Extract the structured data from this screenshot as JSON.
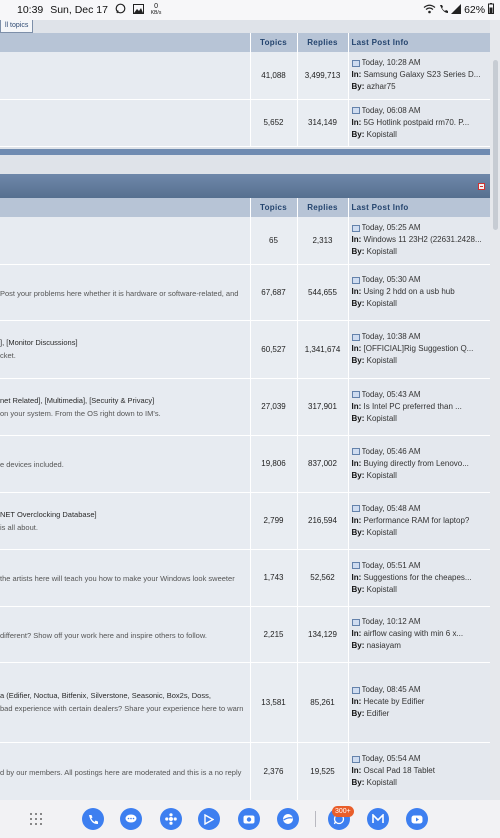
{
  "status_bar": {
    "time": "10:39",
    "date": "Sun, Dec 17",
    "kbs": "0",
    "kbs_unit": "KB/s",
    "battery": "62%"
  },
  "tab_stub": {
    "label": "ll topics"
  },
  "section1": {
    "headers": {
      "topics": "Topics",
      "replies": "Replies",
      "last": "Last Post Info"
    },
    "rows": [
      {
        "title": "",
        "desc": "",
        "topics": "41,088",
        "replies": "3,499,713",
        "time": "Today, 10:28 AM",
        "in_label": "In:",
        "in": "Samsung Galaxy S23 Series D...",
        "by_label": "By:",
        "by": "azhar75"
      },
      {
        "title": "",
        "desc": "",
        "topics": "5,652",
        "replies": "314,149",
        "time": "Today, 06:08 AM",
        "in_label": "In:",
        "in": "5G Hotlink postpaid rm70. P...",
        "by_label": "By:",
        "by": "Kopistall"
      }
    ]
  },
  "section2": {
    "headers": {
      "topics": "Topics",
      "replies": "Replies",
      "last": "Last Post Info"
    },
    "rows": [
      {
        "title": "",
        "desc": "",
        "topics": "65",
        "replies": "2,313",
        "time": "Today, 05:25 AM",
        "in_label": "In:",
        "in": "Windows 11 23H2 (22631.2428...",
        "by_label": "By:",
        "by": "Kopistall"
      },
      {
        "title": "",
        "desc": "Post your problems here whether it is hardware or software-related, and",
        "topics": "67,687",
        "replies": "544,655",
        "time": "Today, 05:30 AM",
        "in_label": "In:",
        "in": "Using 2 hdd on a usb hub",
        "by_label": "By:",
        "by": "Kopistall"
      },
      {
        "title": "], [Monitor Discussions]",
        "desc": "cket.",
        "topics": "60,527",
        "replies": "1,341,674",
        "time": "Today, 10:38 AM",
        "in_label": "In:",
        "in": "[OFFICIAL]Rig Suggestion Q...",
        "by_label": "By:",
        "by": "Kopistall"
      },
      {
        "title": "net Related], [Multimedia], [Security & Privacy]",
        "desc": "on your system. From the OS right down to IM's.",
        "topics": "27,039",
        "replies": "317,901",
        "time": "Today, 05:43 AM",
        "in_label": "In:",
        "in": "Is Intel PC preferred than ...",
        "by_label": "By:",
        "by": "Kopistall"
      },
      {
        "title": "",
        "desc": "e devices included.",
        "topics": "19,806",
        "replies": "837,002",
        "time": "Today, 05:46 AM",
        "in_label": "In:",
        "in": "Buying directly from Lenovo...",
        "by_label": "By:",
        "by": "Kopistall"
      },
      {
        "title": "NET Overclocking Database]",
        "desc": "is all about.",
        "topics": "2,799",
        "replies": "216,594",
        "time": "Today, 05:48 AM",
        "in_label": "In:",
        "in": "Performance RAM for laptop?",
        "by_label": "By:",
        "by": "Kopistall"
      },
      {
        "title": "",
        "desc": "the artists here will teach you how to make your Windows look sweeter",
        "topics": "1,743",
        "replies": "52,562",
        "time": "Today, 05:51 AM",
        "in_label": "In:",
        "in": "Suggestions for the cheapes...",
        "by_label": "By:",
        "by": "Kopistall"
      },
      {
        "title": "",
        "desc": "different? Show off your work here and inspire others to follow.",
        "topics": "2,215",
        "replies": "134,129",
        "time": "Today, 10:12 AM",
        "in_label": "In:",
        "in": "airflow casing with min 6 x...",
        "by_label": "By:",
        "by": "nasiayam"
      },
      {
        "title": "a (Edifier, Noctua, Bitfenix, Silverstone, Seasonic, Box2s, Doss,",
        "desc": "bad experience with certain dealers? Share your experience here to warn",
        "topics": "13,581",
        "replies": "85,261",
        "time": "Today, 08:45 AM",
        "in_label": "In:",
        "in": "Hecate by Edifier",
        "by_label": "By:",
        "by": "Edifier"
      },
      {
        "title": "",
        "desc": "d by our members. All postings here are moderated and this is a no reply",
        "topics": "2,376",
        "replies": "19,525",
        "time": "Today, 05:54 AM",
        "in_label": "In:",
        "in": "Oscal Pad 18 Tablet",
        "by_label": "By:",
        "by": "Kopistall"
      }
    ]
  },
  "dock": {
    "badge": "300+",
    "apps": [
      "apps-grid-icon",
      "phone-icon",
      "messages-icon",
      "bixby-icon",
      "play-store-icon",
      "camera-icon",
      "browser-icon",
      "whatsapp-icon",
      "maxis-icon",
      "youtube-icon"
    ]
  },
  "colors": {
    "header": "#5f7a9c",
    "column_header": "#b7c4d6",
    "row": "#e7ebf1",
    "badge": "#e95e2a"
  }
}
